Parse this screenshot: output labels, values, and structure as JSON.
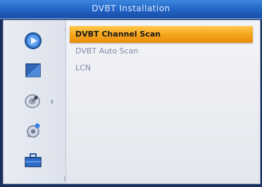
{
  "window": {
    "title": "DVBT Installation"
  },
  "sidebar": {
    "icons": [
      {
        "name": "media-play-icon"
      },
      {
        "name": "picture-icon"
      },
      {
        "name": "satellite-dish-icon"
      },
      {
        "name": "settings-gear-icon"
      },
      {
        "name": "toolbox-icon"
      }
    ]
  },
  "menu": {
    "items": [
      {
        "label": "DVBT Channel Scan",
        "selected": true
      },
      {
        "label": "DVBT Auto Scan",
        "selected": false
      },
      {
        "label": "LCN",
        "selected": false
      }
    ]
  },
  "colors": {
    "accent": "#f4a21a",
    "title_bar": "#1f5fc0",
    "panel": "#eef0f4",
    "text_dim": "#7d8aa7"
  }
}
